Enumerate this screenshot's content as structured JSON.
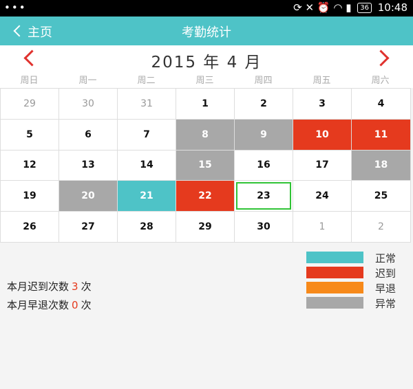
{
  "status_bar": {
    "left": "•••",
    "battery": "36",
    "time": "10:48"
  },
  "header": {
    "back_label": "主页",
    "title": "考勤统计"
  },
  "month": {
    "title": "2015 年 4 月"
  },
  "weekdays": [
    "周日",
    "周一",
    "周二",
    "周三",
    "周四",
    "周五",
    "周六"
  ],
  "colors": {
    "normal": "#4ec3c7",
    "late": "#e53a1e",
    "early": "#f7891a",
    "abnormal": "#a8a8a8",
    "today_border": "#2fc335"
  },
  "days": [
    {
      "label": "29",
      "other": true
    },
    {
      "label": "30",
      "other": true
    },
    {
      "label": "31",
      "other": true
    },
    {
      "label": "1"
    },
    {
      "label": "2"
    },
    {
      "label": "3"
    },
    {
      "label": "4"
    },
    {
      "label": "5"
    },
    {
      "label": "6"
    },
    {
      "label": "7"
    },
    {
      "label": "8",
      "status": "abnormal"
    },
    {
      "label": "9",
      "status": "abnormal"
    },
    {
      "label": "10",
      "status": "late"
    },
    {
      "label": "11",
      "status": "late"
    },
    {
      "label": "12"
    },
    {
      "label": "13"
    },
    {
      "label": "14"
    },
    {
      "label": "15",
      "status": "abnormal"
    },
    {
      "label": "16"
    },
    {
      "label": "17"
    },
    {
      "label": "18",
      "status": "abnormal"
    },
    {
      "label": "19"
    },
    {
      "label": "20",
      "status": "abnormal"
    },
    {
      "label": "21",
      "status": "normal"
    },
    {
      "label": "22",
      "status": "late"
    },
    {
      "label": "23",
      "today": true
    },
    {
      "label": "24"
    },
    {
      "label": "25"
    },
    {
      "label": "26"
    },
    {
      "label": "27"
    },
    {
      "label": "28"
    },
    {
      "label": "29"
    },
    {
      "label": "30"
    },
    {
      "label": "1",
      "other": true
    },
    {
      "label": "2",
      "other": true
    }
  ],
  "legend": [
    {
      "label": "正常",
      "status": "normal"
    },
    {
      "label": "迟到",
      "status": "late"
    },
    {
      "label": "早退",
      "status": "early"
    },
    {
      "label": "异常",
      "status": "abnormal"
    }
  ],
  "stats": {
    "late_prefix": "本月迟到次数",
    "late_count": "3",
    "late_suffix": "次",
    "early_prefix": "本月早退次数",
    "early_count": "0",
    "early_suffix": "次"
  }
}
